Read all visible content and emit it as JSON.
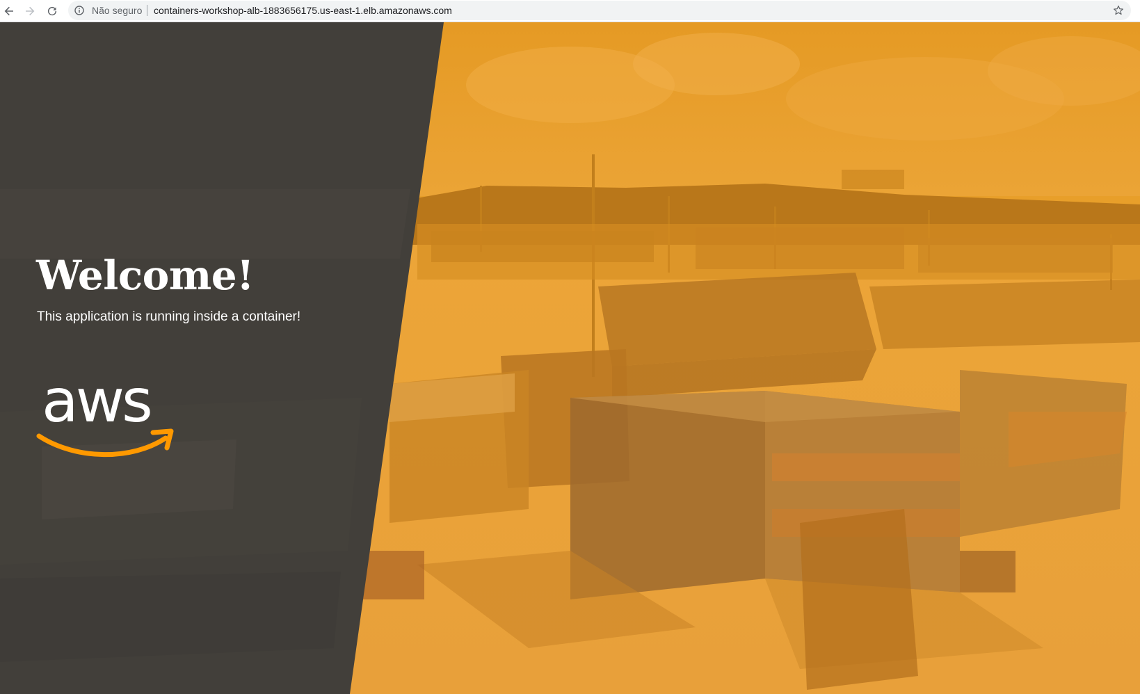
{
  "browser": {
    "security_label": "Não seguro",
    "url": "containers-workshop-alb-1883656175.us-east-1.elb.amazonaws.com",
    "icons": {
      "back": "arrow-left-icon",
      "forward": "arrow-right-icon",
      "reload": "reload-icon",
      "info": "info-icon",
      "bookmark": "star-icon"
    }
  },
  "page": {
    "title": "Welcome!",
    "subtitle": "This application is running inside a container!",
    "logo": {
      "text": "aws",
      "icon": "aws-logo-icon"
    }
  },
  "colors": {
    "panel": "#3f3c38",
    "accent": "#ff9900",
    "overlay_orange": "#e89f2a"
  }
}
